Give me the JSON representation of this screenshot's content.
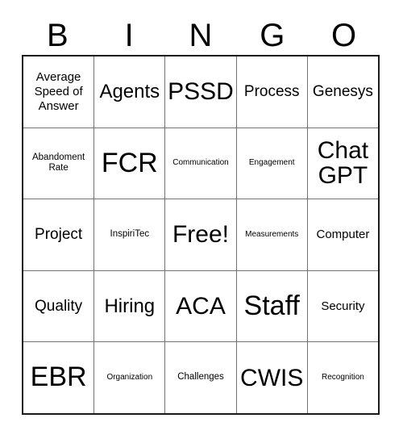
{
  "card": {
    "title": "BINGO",
    "header_letters": [
      "B",
      "I",
      "N",
      "G",
      "O"
    ],
    "free_space_label": "Free!",
    "colors": {
      "background": "#ffffff",
      "text": "#000000",
      "outer_border": "#1a1a1a",
      "inner_border": "#737373"
    },
    "rows": [
      [
        {
          "text": "Average Speed of Answer",
          "size": "sm"
        },
        {
          "text": "Agents",
          "size": "lg"
        },
        {
          "text": "PSSD",
          "size": "xl"
        },
        {
          "text": "Process",
          "size": "md"
        },
        {
          "text": "Genesys",
          "size": "md"
        }
      ],
      [
        {
          "text": "Abandoment Rate",
          "size": "xs"
        },
        {
          "text": "FCR",
          "size": "xxl"
        },
        {
          "text": "Communication",
          "size": "xxs"
        },
        {
          "text": "Engagement",
          "size": "xxs"
        },
        {
          "text": "Chat GPT",
          "size": "xl"
        }
      ],
      [
        {
          "text": "Project",
          "size": "md"
        },
        {
          "text": "InspiriTec",
          "size": "xs"
        },
        {
          "text": "Free!",
          "size": "xl"
        },
        {
          "text": "Measurements",
          "size": "xxs"
        },
        {
          "text": "Computer",
          "size": "sm"
        }
      ],
      [
        {
          "text": "Quality",
          "size": "md"
        },
        {
          "text": "Hiring",
          "size": "lg"
        },
        {
          "text": "ACA",
          "size": "xl"
        },
        {
          "text": "Staff",
          "size": "xxl"
        },
        {
          "text": "Security",
          "size": "sm"
        }
      ],
      [
        {
          "text": "EBR",
          "size": "xxl"
        },
        {
          "text": "Organization",
          "size": "xxs"
        },
        {
          "text": "Challenges",
          "size": "xs"
        },
        {
          "text": "CWIS",
          "size": "xl"
        },
        {
          "text": "Recognition",
          "size": "xxs"
        }
      ]
    ]
  }
}
